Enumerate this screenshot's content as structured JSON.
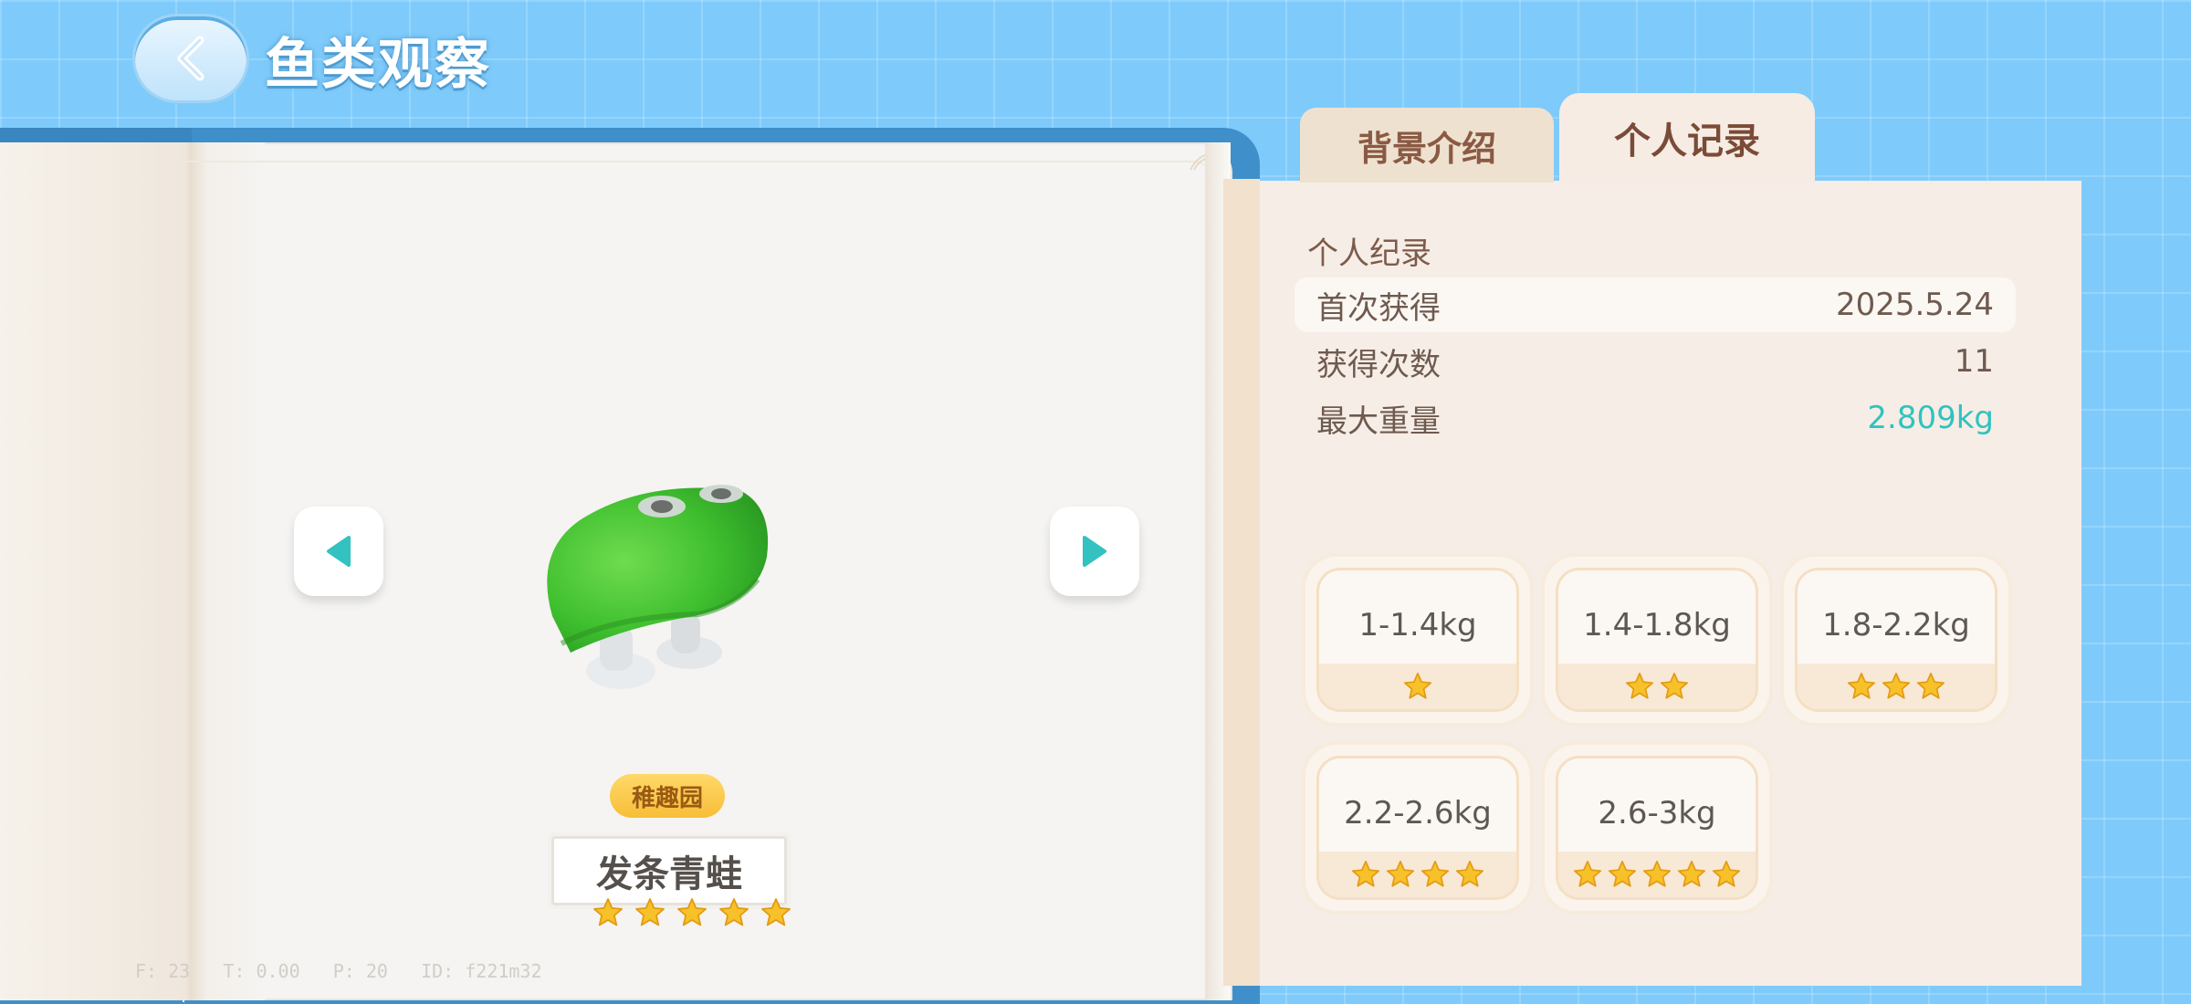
{
  "header": {
    "title": "鱼类观察"
  },
  "fish": {
    "location": "稚趣园",
    "name": "发条青蛙",
    "rarity_stars": 5
  },
  "debug": "F: 23   T: 0.00   P: 20   ID: f221m32",
  "tabs": [
    {
      "label": "背景介绍",
      "active": false
    },
    {
      "label": "个人记录",
      "active": true
    }
  ],
  "record": {
    "section_title": "个人纪录",
    "rows": [
      {
        "label": "首次获得",
        "value": "2025.5.24"
      },
      {
        "label": "获得次数",
        "value": "11"
      },
      {
        "label": "最大重量",
        "value": "2.809kg"
      }
    ]
  },
  "weight_ranges": [
    {
      "range": "1-1.4kg",
      "stars": 1
    },
    {
      "range": "1.4-1.8kg",
      "stars": 2
    },
    {
      "range": "1.8-2.2kg",
      "stars": 3
    },
    {
      "range": "2.2-2.6kg",
      "stars": 4
    },
    {
      "range": "2.6-3kg",
      "stars": 5
    }
  ],
  "colors": {
    "background": "#7ecbfb",
    "accent_teal": "#2fc3c0",
    "star": "#f7c12a",
    "tab_text": "#8a5a44"
  },
  "icons": {
    "back": "chevron-left-icon",
    "prev": "triangle-left-icon",
    "next": "triangle-right-icon",
    "star": "star-icon"
  }
}
